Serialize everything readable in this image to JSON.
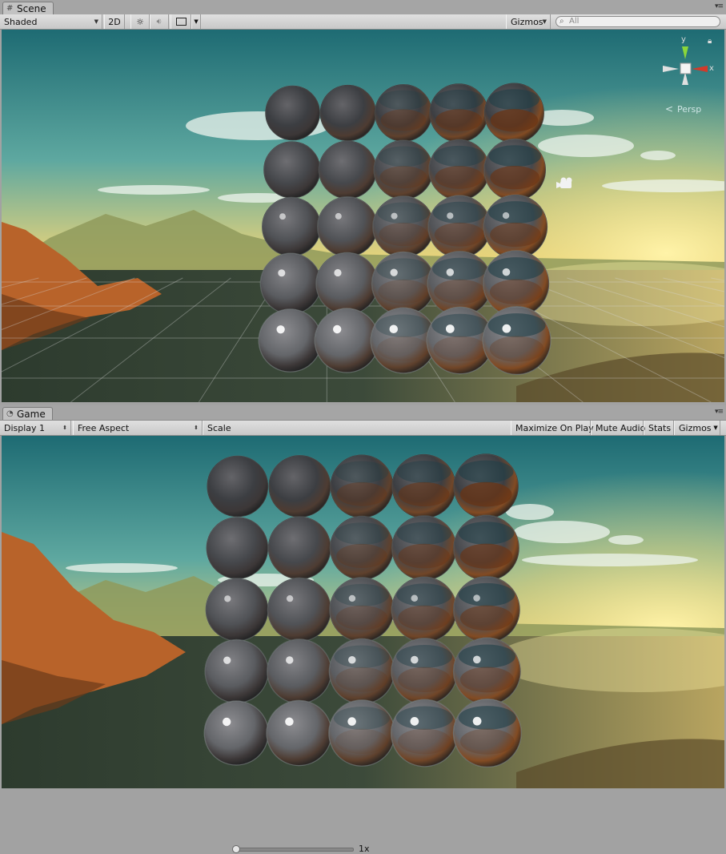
{
  "scene_tab": {
    "label": "Scene",
    "icon": "grid-icon"
  },
  "scene_toolbar": {
    "draw_mode": "Shaded",
    "mode_2d": "2D",
    "lighting_icon": "sun-icon",
    "audio_icon": "speaker-icon",
    "effects_icon": "image-icon",
    "gizmos": "Gizmos",
    "search_placeholder": "All"
  },
  "scene_gizmo": {
    "y_label": "y",
    "x_label": "x",
    "projection": "Persp"
  },
  "game_tab": {
    "label": "Game",
    "icon": "pacman-icon"
  },
  "game_toolbar": {
    "display": "Display 1",
    "aspect": "Free Aspect",
    "scale_label": "Scale",
    "scale_value": "1x",
    "scale_fraction": 0.0,
    "maximize": "Maximize On Play",
    "mute": "Mute Audio",
    "stats": "Stats",
    "gizmos": "Gizmos"
  },
  "colors": {
    "sky_top": "#1e6b73",
    "sky_mid": "#5ea8a0",
    "horizon": "#e9d47a",
    "sun": "#fff3a8",
    "water": "#3c4a3a",
    "rock": "#b8632a",
    "gizmo_y": "#8bd63a",
    "gizmo_x": "#d23a2a"
  },
  "spheres": {
    "rows": 5,
    "cols": 5,
    "metallic_by_col": [
      0.0,
      0.25,
      0.5,
      0.75,
      1.0
    ],
    "smoothness_by_row": [
      0.0,
      0.25,
      0.5,
      0.75,
      1.0
    ]
  }
}
